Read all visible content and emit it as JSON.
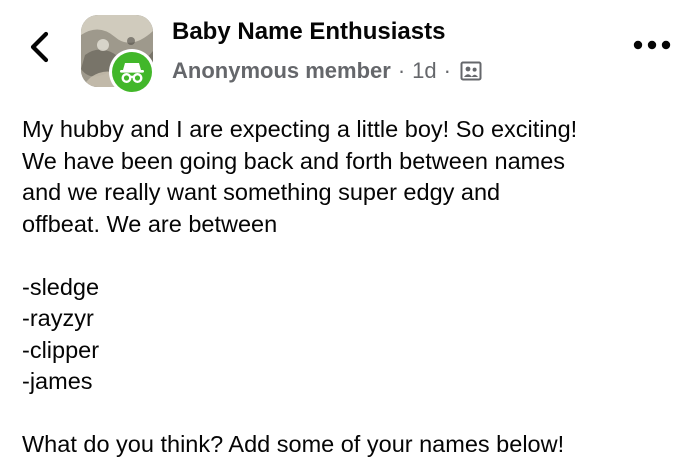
{
  "group": {
    "name": "Baby Name Enthusiasts"
  },
  "post": {
    "author": "Anonymous member",
    "separator": "·",
    "time": "1d",
    "privacy_icon": "members-only-icon",
    "intro_lines": [
      "My hubby and I are expecting a little boy! So exciting!",
      "We have been going back and forth between names",
      "and we really want something super edgy and",
      "offbeat. We are between"
    ],
    "names": [
      "-sledge",
      "-rayzyr",
      "-clipper",
      "-james"
    ],
    "closing": "What do you think? Add some of your names below!"
  },
  "icons": {
    "back": "chevron-left-icon",
    "more": "more-dots-icon",
    "anonymous": "incognito-icon"
  },
  "colors": {
    "text": "#050505",
    "meta": "#65676b",
    "anonymous_badge": "#42b72a"
  }
}
